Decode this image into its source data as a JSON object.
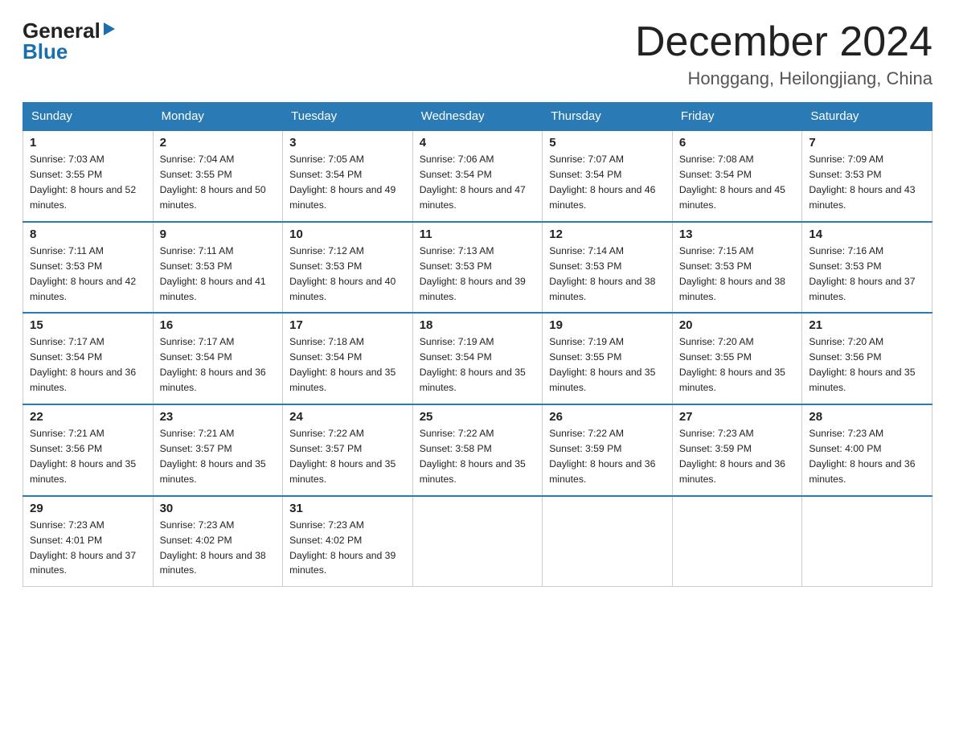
{
  "header": {
    "logo_general": "General",
    "logo_blue": "Blue",
    "month_title": "December 2024",
    "location": "Honggang, Heilongjiang, China"
  },
  "weekdays": [
    "Sunday",
    "Monday",
    "Tuesday",
    "Wednesday",
    "Thursday",
    "Friday",
    "Saturday"
  ],
  "weeks": [
    [
      {
        "day": 1,
        "sunrise": "7:03 AM",
        "sunset": "3:55 PM",
        "daylight": "8 hours and 52 minutes."
      },
      {
        "day": 2,
        "sunrise": "7:04 AM",
        "sunset": "3:55 PM",
        "daylight": "8 hours and 50 minutes."
      },
      {
        "day": 3,
        "sunrise": "7:05 AM",
        "sunset": "3:54 PM",
        "daylight": "8 hours and 49 minutes."
      },
      {
        "day": 4,
        "sunrise": "7:06 AM",
        "sunset": "3:54 PM",
        "daylight": "8 hours and 47 minutes."
      },
      {
        "day": 5,
        "sunrise": "7:07 AM",
        "sunset": "3:54 PM",
        "daylight": "8 hours and 46 minutes."
      },
      {
        "day": 6,
        "sunrise": "7:08 AM",
        "sunset": "3:54 PM",
        "daylight": "8 hours and 45 minutes."
      },
      {
        "day": 7,
        "sunrise": "7:09 AM",
        "sunset": "3:53 PM",
        "daylight": "8 hours and 43 minutes."
      }
    ],
    [
      {
        "day": 8,
        "sunrise": "7:11 AM",
        "sunset": "3:53 PM",
        "daylight": "8 hours and 42 minutes."
      },
      {
        "day": 9,
        "sunrise": "7:11 AM",
        "sunset": "3:53 PM",
        "daylight": "8 hours and 41 minutes."
      },
      {
        "day": 10,
        "sunrise": "7:12 AM",
        "sunset": "3:53 PM",
        "daylight": "8 hours and 40 minutes."
      },
      {
        "day": 11,
        "sunrise": "7:13 AM",
        "sunset": "3:53 PM",
        "daylight": "8 hours and 39 minutes."
      },
      {
        "day": 12,
        "sunrise": "7:14 AM",
        "sunset": "3:53 PM",
        "daylight": "8 hours and 38 minutes."
      },
      {
        "day": 13,
        "sunrise": "7:15 AM",
        "sunset": "3:53 PM",
        "daylight": "8 hours and 38 minutes."
      },
      {
        "day": 14,
        "sunrise": "7:16 AM",
        "sunset": "3:53 PM",
        "daylight": "8 hours and 37 minutes."
      }
    ],
    [
      {
        "day": 15,
        "sunrise": "7:17 AM",
        "sunset": "3:54 PM",
        "daylight": "8 hours and 36 minutes."
      },
      {
        "day": 16,
        "sunrise": "7:17 AM",
        "sunset": "3:54 PM",
        "daylight": "8 hours and 36 minutes."
      },
      {
        "day": 17,
        "sunrise": "7:18 AM",
        "sunset": "3:54 PM",
        "daylight": "8 hours and 35 minutes."
      },
      {
        "day": 18,
        "sunrise": "7:19 AM",
        "sunset": "3:54 PM",
        "daylight": "8 hours and 35 minutes."
      },
      {
        "day": 19,
        "sunrise": "7:19 AM",
        "sunset": "3:55 PM",
        "daylight": "8 hours and 35 minutes."
      },
      {
        "day": 20,
        "sunrise": "7:20 AM",
        "sunset": "3:55 PM",
        "daylight": "8 hours and 35 minutes."
      },
      {
        "day": 21,
        "sunrise": "7:20 AM",
        "sunset": "3:56 PM",
        "daylight": "8 hours and 35 minutes."
      }
    ],
    [
      {
        "day": 22,
        "sunrise": "7:21 AM",
        "sunset": "3:56 PM",
        "daylight": "8 hours and 35 minutes."
      },
      {
        "day": 23,
        "sunrise": "7:21 AM",
        "sunset": "3:57 PM",
        "daylight": "8 hours and 35 minutes."
      },
      {
        "day": 24,
        "sunrise": "7:22 AM",
        "sunset": "3:57 PM",
        "daylight": "8 hours and 35 minutes."
      },
      {
        "day": 25,
        "sunrise": "7:22 AM",
        "sunset": "3:58 PM",
        "daylight": "8 hours and 35 minutes."
      },
      {
        "day": 26,
        "sunrise": "7:22 AM",
        "sunset": "3:59 PM",
        "daylight": "8 hours and 36 minutes."
      },
      {
        "day": 27,
        "sunrise": "7:23 AM",
        "sunset": "3:59 PM",
        "daylight": "8 hours and 36 minutes."
      },
      {
        "day": 28,
        "sunrise": "7:23 AM",
        "sunset": "4:00 PM",
        "daylight": "8 hours and 36 minutes."
      }
    ],
    [
      {
        "day": 29,
        "sunrise": "7:23 AM",
        "sunset": "4:01 PM",
        "daylight": "8 hours and 37 minutes."
      },
      {
        "day": 30,
        "sunrise": "7:23 AM",
        "sunset": "4:02 PM",
        "daylight": "8 hours and 38 minutes."
      },
      {
        "day": 31,
        "sunrise": "7:23 AM",
        "sunset": "4:02 PM",
        "daylight": "8 hours and 39 minutes."
      },
      null,
      null,
      null,
      null
    ]
  ]
}
